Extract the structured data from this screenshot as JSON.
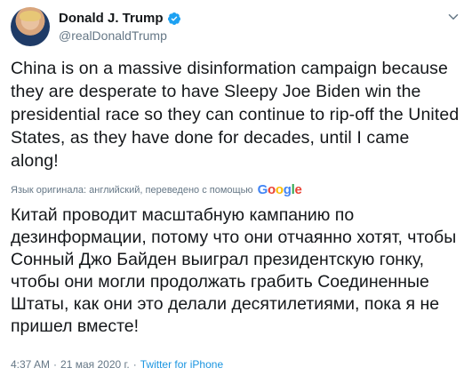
{
  "author": {
    "name": "Donald J. Trump",
    "handle": "@realDonaldTrump"
  },
  "tweet": {
    "text": "China is on a massive disinformation campaign because they are desperate to have Sleepy Joe Biden win the presidential race so they can continue to rip-off the United States, as they have done for decades, until I came along!",
    "translation_note": "Язык оригинала: английский, переведено с помощью",
    "translation_provider": "Google",
    "translated_text": "Китай проводит масштабную кампанию по дезинформации, потому что они отчаянно хотят, чтобы Сонный Джо Байден выиграл президентскую гонку, чтобы они могли продолжать грабить Соединенные Штаты, как они это делали десятилетиями, пока я не пришел вместе!",
    "time": "4:37 AM",
    "separator": "·",
    "date": "21 мая 2020 г.",
    "source": "Twitter for iPhone"
  },
  "colors": {
    "text": "#14171a",
    "secondary": "#657786",
    "link": "#1b95e0",
    "verified": "#1da1f2"
  },
  "icons": {
    "verified": "verified-badge-icon",
    "menu": "chevron-down-icon"
  }
}
